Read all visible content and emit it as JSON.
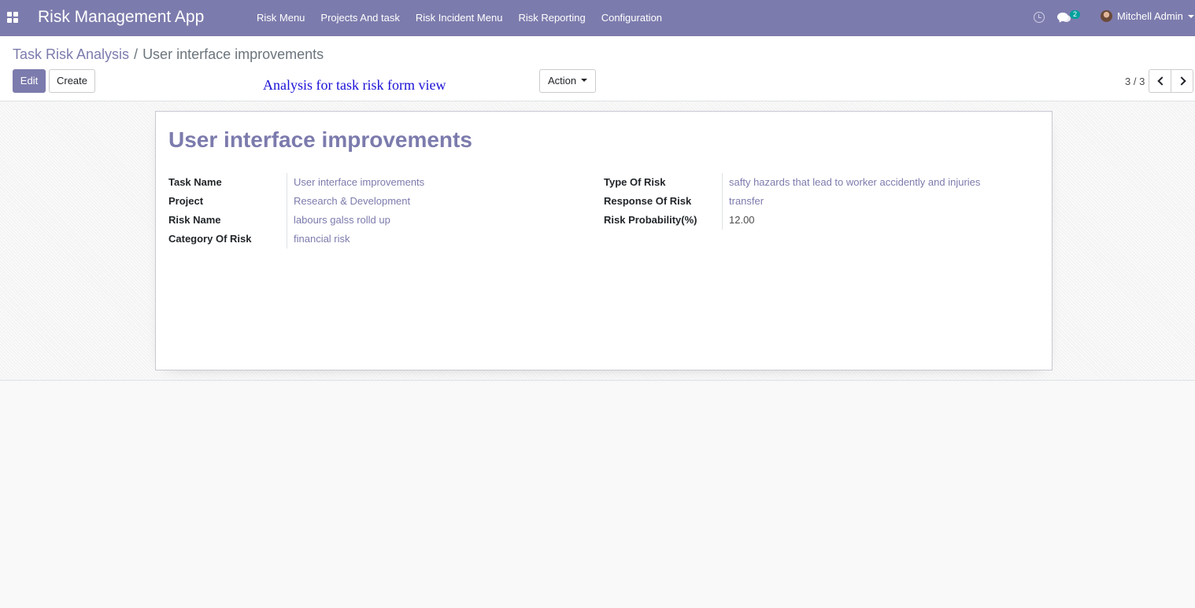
{
  "navbar": {
    "app_title": "Risk Management App",
    "menu": [
      "Risk Menu",
      "Projects And task",
      "Risk Incident Menu",
      "Risk Reporting",
      "Configuration"
    ],
    "chat_count": "2",
    "user_name": "Mitchell Admin"
  },
  "breadcrumb": {
    "parent": "Task Risk Analysis",
    "separator": "/",
    "current": "User interface improvements"
  },
  "buttons": {
    "edit": "Edit",
    "create": "Create",
    "action": "Action"
  },
  "annotation": "Analysis for task risk  form view",
  "pager": {
    "value": "3 / 3"
  },
  "record": {
    "title": "User interface improvements",
    "left_fields": [
      {
        "label": "Task Name",
        "value": "User interface improvements"
      },
      {
        "label": "Project",
        "value": "Research & Development"
      },
      {
        "label": "Risk Name",
        "value": "labours galss rolld up"
      },
      {
        "label": "Category Of Risk",
        "value": "financial risk"
      }
    ],
    "right_fields": [
      {
        "label": "Type Of Risk",
        "value": "safty hazards that lead to worker accidently and injuries"
      },
      {
        "label": "Response Of Risk",
        "value": "transfer"
      },
      {
        "label": "Risk Probability(%)",
        "value": "12.00"
      }
    ]
  },
  "colors": {
    "brand": "#7c7bad",
    "annotation": "#1a10d6",
    "badge": "#00a09d"
  }
}
